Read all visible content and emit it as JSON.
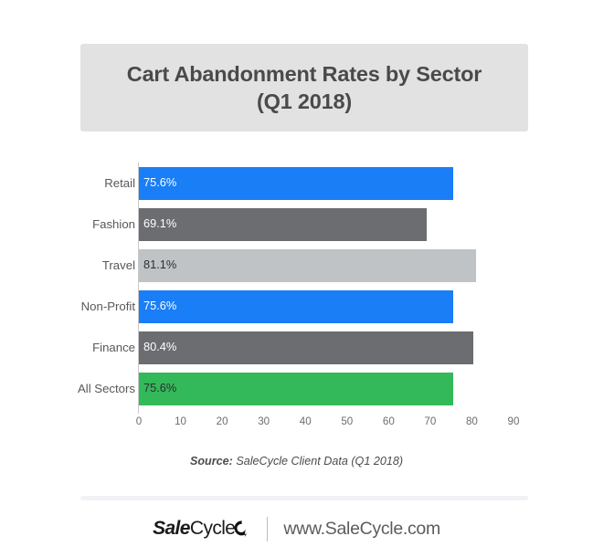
{
  "title": {
    "line1": "Cart Abandonment Rates by Sector",
    "line2": "(Q1 2018)"
  },
  "source": {
    "label": "Source:",
    "text": " SaleCycle Client Data (Q1 2018)"
  },
  "footer": {
    "logo_bold": "Sale",
    "logo_regular": "Cycle",
    "url": "www.SaleCycle.com"
  },
  "colors": {
    "blue": "#1a7ef7",
    "dark_gray": "#6b6d70",
    "light_gray": "#c0c3c6",
    "green": "#33b95a",
    "banner": "#e2e2e2",
    "title_text": "#4a4a4a",
    "axis": "#c9c9c9"
  },
  "chart_data": {
    "type": "bar",
    "orientation": "horizontal",
    "title": "Cart Abandonment Rates by Sector (Q1 2018)",
    "xlabel": "",
    "ylabel": "",
    "xlim": [
      0,
      90
    ],
    "xticks": [
      0,
      10,
      20,
      30,
      40,
      50,
      60,
      70,
      80,
      90
    ],
    "grid": false,
    "legend": "none",
    "categories": [
      "Retail",
      "Fashion",
      "Travel",
      "Non-Profit",
      "Finance",
      "All Sectors"
    ],
    "values": [
      75.6,
      69.1,
      81.1,
      75.6,
      80.4,
      75.6
    ],
    "value_labels": [
      "75.6%",
      "69.1%",
      "81.1%",
      "75.6%",
      "80.4%",
      "75.6%"
    ],
    "bar_colors": [
      "#1a7ef7",
      "#6b6d70",
      "#c0c3c6",
      "#1a7ef7",
      "#6b6d70",
      "#33b95a"
    ],
    "label_text_colors": [
      "light",
      "light",
      "dark",
      "light",
      "light",
      "dark"
    ]
  }
}
